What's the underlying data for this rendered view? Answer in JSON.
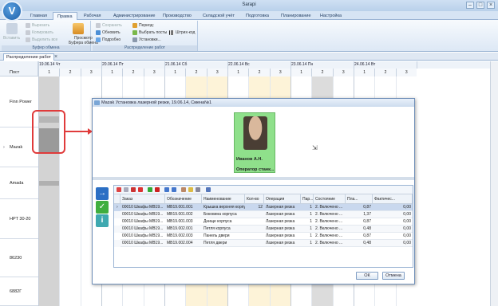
{
  "app": {
    "title": "Sarapi",
    "logo": "V"
  },
  "menu_tabs": [
    "Главная",
    "Правка",
    "Рабочая",
    "Администрирование",
    "Производство",
    "Складской учёт",
    "Подготовка",
    "Планирование",
    "Настройка"
  ],
  "ribbon": {
    "clipboard": {
      "paste": "Вставить",
      "cut": "Вырезать",
      "copy": "Копировать",
      "copy_all": "Выделить все",
      "view": "Просмотр",
      "view2": "Буфера обмена",
      "group": "Буфер обмена"
    },
    "distribution": {
      "save": "Сохранить",
      "refresh": "Обновить",
      "details": "Подробно",
      "period": "Период:",
      "select_posts": "Выбрать посты",
      "settings": "Установки...",
      "barcode": "Штрих-код",
      "group": "Распределение работ"
    }
  },
  "doc_tab": {
    "label": "Распределение работ",
    "close": "×"
  },
  "grid": {
    "corner": "Пост",
    "dates": [
      "19.06.14 Чт",
      "20.06.14 Пт",
      "21.06.14 Сб",
      "22.06.14 Вс",
      "23.06.14 Пн",
      "24.06.14 Вт"
    ],
    "shift_labels": [
      "1",
      "2",
      "3"
    ],
    "posts": [
      "Finn Power",
      "Mazak",
      "Amada",
      "HPT 30-20",
      "86230",
      "6882Г"
    ],
    "selected_marker": "›"
  },
  "dialog": {
    "title": "Mazak Установка лазерной резки, 19.06.14, Смена№1",
    "operator_name": "Иванов А.Н.",
    "operator_role": "Оператор станк...",
    "columns": [
      "Заказ",
      "Обозначение",
      "Наименование",
      "Кол-во",
      "Операция",
      "Пар...",
      "Состояние",
      "Пла...",
      "Фактичес..."
    ],
    "rows": [
      [
        "00010 Шкафы МВ19...",
        "МВ19.001.001",
        "Крышка верхняя корпуса",
        "12",
        "Лазерная резка",
        "1",
        "2. Включено ...",
        "0,87",
        "0,00"
      ],
      [
        "00010 Шкафы МВ19...",
        "МВ19.001.002",
        "Боковина корпуса",
        "",
        "Лазерная резка",
        "1",
        "2. Включено ...",
        "1,37",
        "0,00"
      ],
      [
        "00010 Шкафы МВ19...",
        "МВ19.001.003",
        "Днище корпуса",
        "",
        "Лазерная резка",
        "1",
        "2. Включено ...",
        "0,87",
        "0,00"
      ],
      [
        "00010 Шкафы МВ19...",
        "МВ19.002.001",
        "Петля корпуса",
        "",
        "Лазерная резка",
        "1",
        "2. Включено ...",
        "0,48",
        "0,00"
      ],
      [
        "00010 Шкафы МВ19...",
        "МВ19.002.003",
        "Панель двери",
        "",
        "Лазерная резка",
        "1",
        "2. Включено ...",
        "0,87",
        "0,00"
      ],
      [
        "00010 Шкафы МВ19...",
        "МВ19.002.004",
        "Петля двери",
        "",
        "Лазерная резка",
        "1",
        "2. Включено ...",
        "0,48",
        "0,00"
      ]
    ],
    "ok": "ОК",
    "cancel": "Отмена"
  }
}
